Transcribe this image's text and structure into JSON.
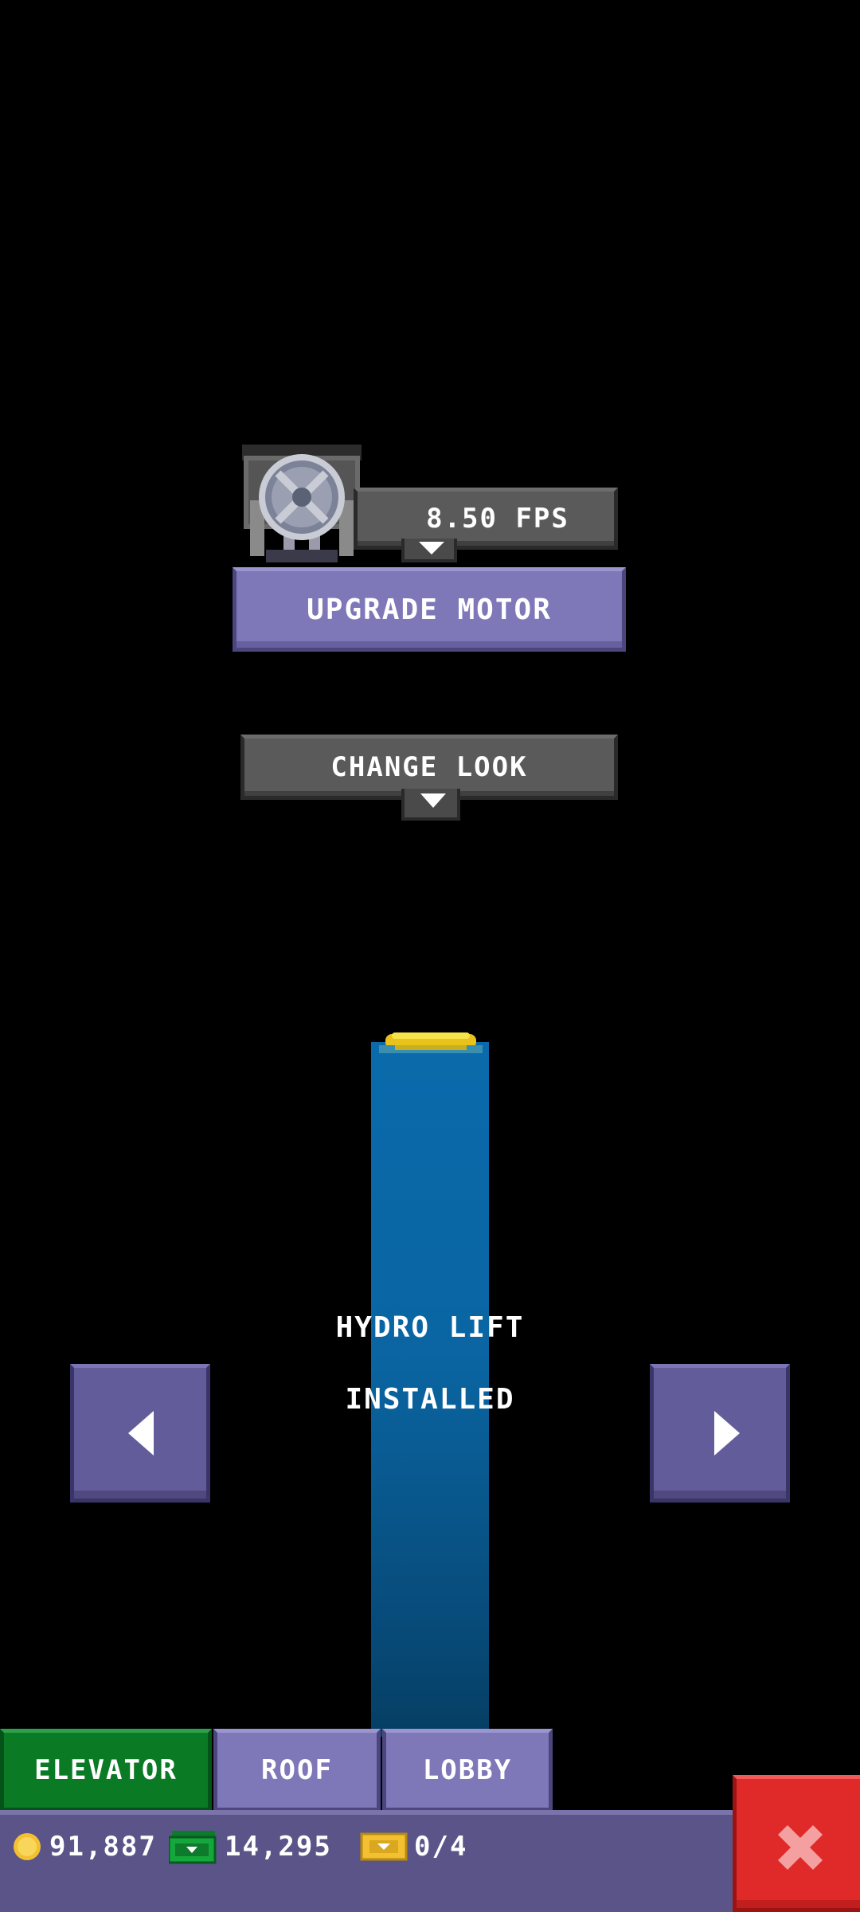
{
  "motor": {
    "icon": "motor-gear-icon",
    "speed_label": "8.50 FPS",
    "upgrade_label": "UPGRADE MOTOR"
  },
  "look": {
    "change_label": "CHANGE LOOK"
  },
  "elevator": {
    "name": "HYDRO LIFT",
    "status": "INSTALLED",
    "prev_icon": "left-arrow-icon",
    "next_icon": "right-arrow-icon"
  },
  "tabs": [
    {
      "label": "ELEVATOR",
      "active": true
    },
    {
      "label": "ROOF",
      "active": false
    },
    {
      "label": "LOBBY",
      "active": false
    }
  ],
  "status": {
    "coins": "91,887",
    "bux": "14,295",
    "tickets": "0/4",
    "coin_icon": "coin-icon",
    "bux_icon": "bux-icon",
    "ticket_icon": "ticket-icon"
  },
  "close_icon": "close-x-icon",
  "colors": {
    "background": "#000000",
    "purple_button": "#7e78b8",
    "gray_button": "#5a5a5a",
    "active_tab": "#0b7a24",
    "shaft": "#0a6aab",
    "close": "#e02a2a",
    "coin": "#f2c030"
  }
}
